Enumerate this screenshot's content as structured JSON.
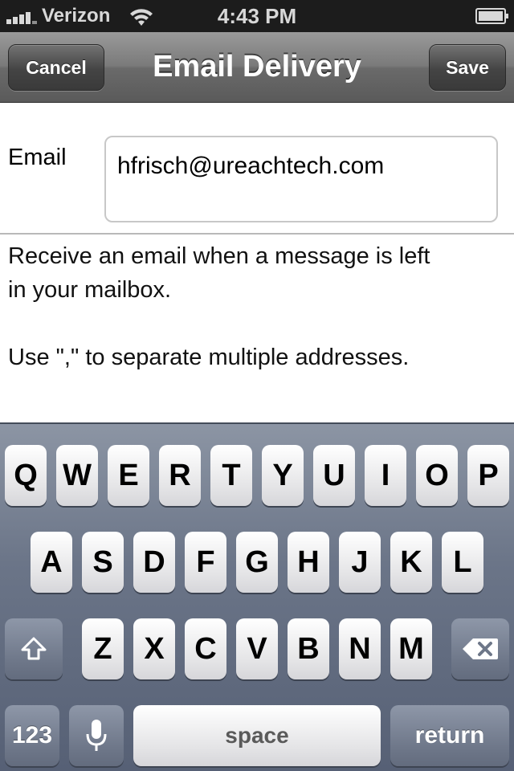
{
  "status_bar": {
    "carrier": "Verizon",
    "time": "4:43 PM"
  },
  "nav": {
    "title": "Email Delivery",
    "cancel_label": "Cancel",
    "save_label": "Save"
  },
  "form": {
    "email_label": "Email",
    "email_value": "hfrisch@ureachtech.com"
  },
  "help": {
    "line1": "Receive an email when a message is left",
    "line2": "in your mailbox.",
    "line3": "Use \",\" to separate multiple addresses."
  },
  "keyboard": {
    "row1": [
      "Q",
      "W",
      "E",
      "R",
      "T",
      "Y",
      "U",
      "I",
      "O",
      "P"
    ],
    "row2": [
      "A",
      "S",
      "D",
      "F",
      "G",
      "H",
      "J",
      "K",
      "L"
    ],
    "row3": [
      "Z",
      "X",
      "C",
      "V",
      "B",
      "N",
      "M"
    ],
    "numbers_label": "123",
    "space_label": "space",
    "return_label": "return",
    "icons": {
      "shift": "shift-icon",
      "backspace": "backspace-icon",
      "mic": "microphone-icon"
    }
  }
}
